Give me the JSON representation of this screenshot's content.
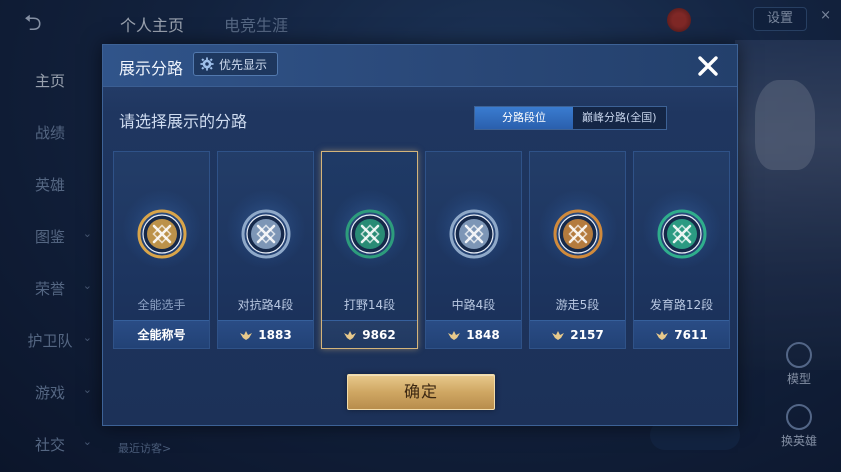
{
  "background": {
    "back_glyph": "⮌",
    "tabs": [
      "个人主页",
      "电竞生涯"
    ],
    "sidebar": [
      "主页",
      "战绩",
      "英雄",
      "图鉴",
      "荣誉",
      "护卫队",
      "游戏",
      "社交"
    ],
    "settings_label": "设置",
    "close_glyph": "×",
    "right_buttons": [
      "模型",
      "换英雄"
    ],
    "visitors_label": "最近访客>"
  },
  "modal": {
    "title": "展示分路",
    "priority_label": "优先显示",
    "close_icon": "close-icon",
    "subtitle": "请选择展示的分路",
    "toggle": [
      "分路段位",
      "巅峰分路(全国)"
    ],
    "toggle_active_index": 0,
    "lanes": [
      {
        "name": "全能选手",
        "value": "全能称号",
        "icon": "all-round-emblem",
        "color": "#d9a54a",
        "selected": false
      },
      {
        "name": "对抗路4段",
        "value": "1883",
        "icon": "clash-lane-emblem",
        "color": "#8fa9c9",
        "selected": false
      },
      {
        "name": "打野14段",
        "value": "9862",
        "icon": "jungle-emblem",
        "color": "#2d9c7c",
        "selected": true
      },
      {
        "name": "中路4段",
        "value": "1848",
        "icon": "mid-lane-emblem",
        "color": "#8fa9c9",
        "selected": false
      },
      {
        "name": "游走5段",
        "value": "2157",
        "icon": "roam-emblem",
        "color": "#d08a3c",
        "selected": false
      },
      {
        "name": "发育路12段",
        "value": "7611",
        "icon": "farm-lane-emblem",
        "color": "#2fae8c",
        "selected": false
      }
    ],
    "confirm_label": "确定"
  }
}
